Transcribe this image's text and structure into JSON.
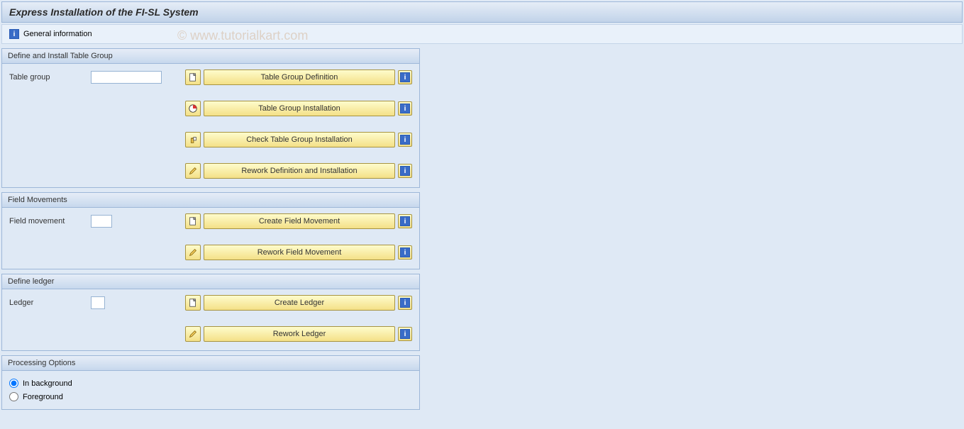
{
  "title": "Express Installation of the FI-SL System",
  "toolbar": {
    "general_info_label": "General information"
  },
  "groups": {
    "table_group": {
      "title": "Define and Install Table Group",
      "field_label": "Table group",
      "field_value": "",
      "buttons": {
        "definition": "Table Group Definition",
        "installation": "Table Group Installation",
        "check": "Check Table Group Installation",
        "rework": "Rework Definition and Installation"
      }
    },
    "field_movements": {
      "title": "Field Movements",
      "field_label": "Field movement",
      "field_value": "",
      "buttons": {
        "create": "Create Field Movement",
        "rework": "Rework Field Movement"
      }
    },
    "define_ledger": {
      "title": "Define ledger",
      "field_label": "Ledger",
      "field_value": "",
      "buttons": {
        "create": "Create Ledger",
        "rework": "Rework Ledger"
      }
    },
    "processing_options": {
      "title": "Processing Options",
      "in_background": "In background",
      "foreground": "Foreground",
      "selected": "in_background"
    }
  },
  "watermark": "© www.tutorialkart.com"
}
